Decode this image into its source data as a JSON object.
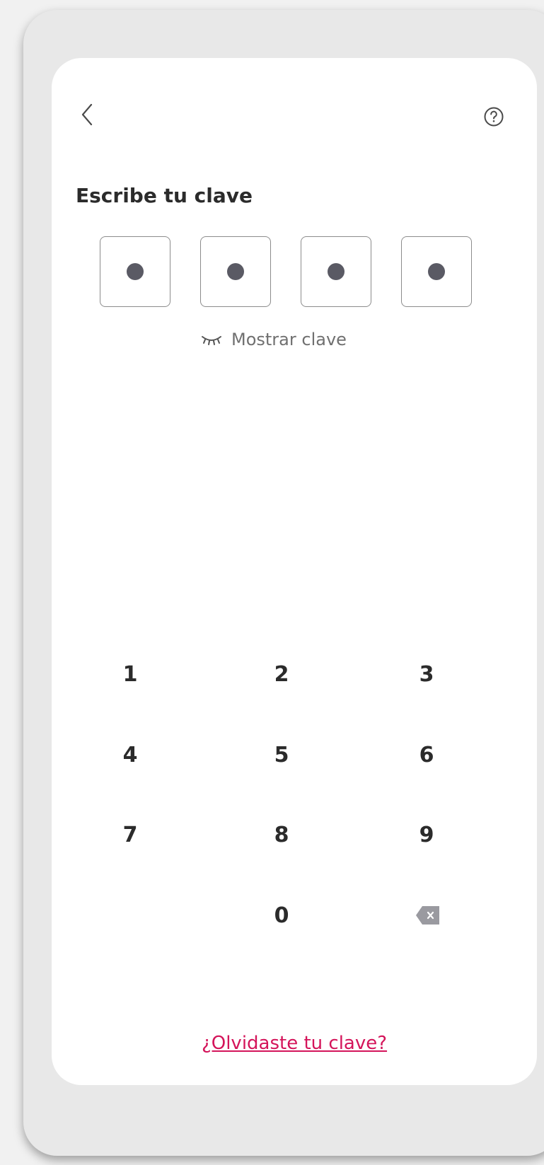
{
  "header": {
    "back_icon": "chevron-left-icon",
    "help_icon": "question-circle-icon"
  },
  "title": "Escribe tu clave",
  "pin": {
    "length": 4,
    "filled": 4
  },
  "show_key": {
    "icon": "eye-closed-icon",
    "label": "Mostrar clave"
  },
  "keypad": {
    "keys": [
      "1",
      "2",
      "3",
      "4",
      "5",
      "6",
      "7",
      "8",
      "9",
      "0"
    ],
    "delete_icon": "backspace-icon"
  },
  "forgot_link": "¿Olvidaste tu clave?",
  "colors": {
    "accent": "#d4145a",
    "dot": "#5a5a64",
    "text": "#2b2b2b",
    "muted": "#707070",
    "delete_bg": "#9a9aa0"
  }
}
